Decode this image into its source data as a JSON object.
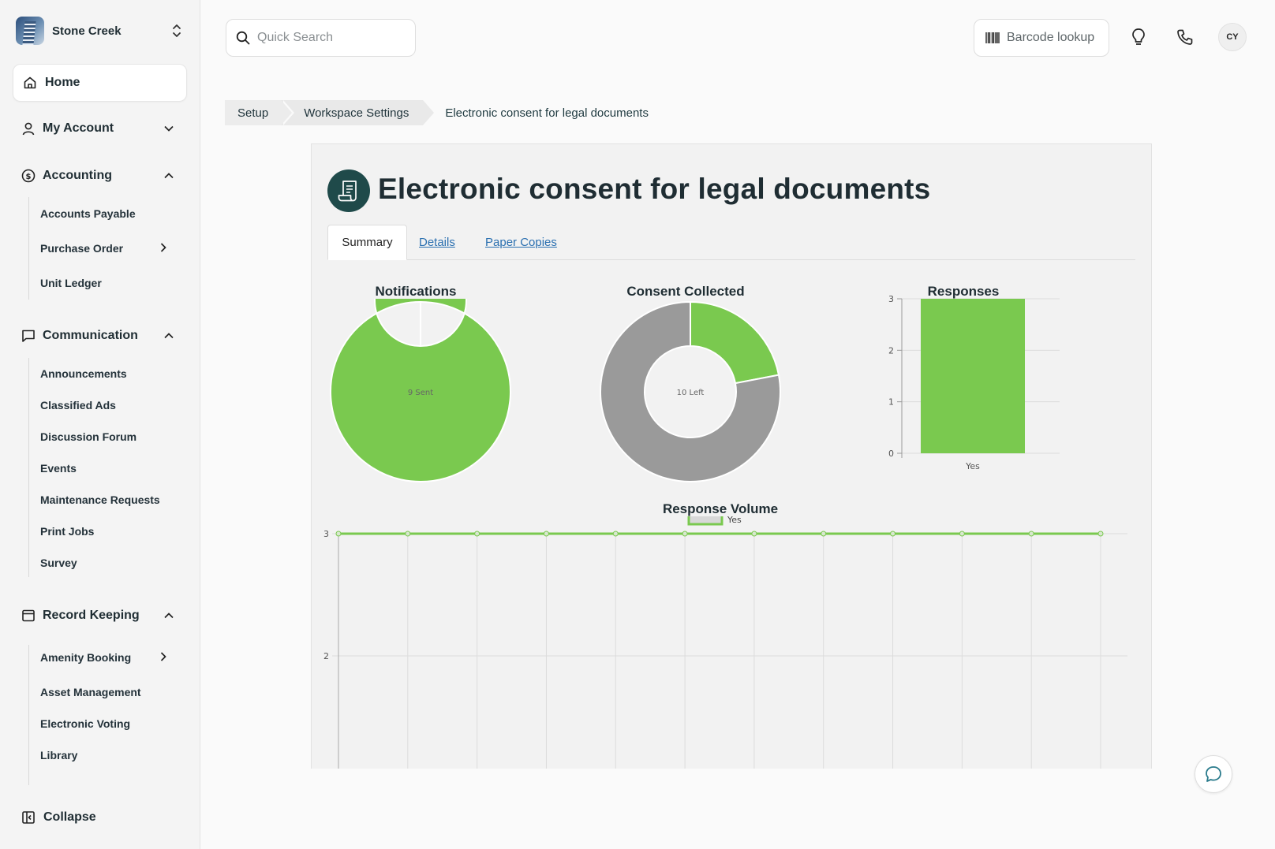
{
  "org": {
    "name": "Stone Creek"
  },
  "nav": {
    "home": "Home",
    "my_account": "My Account",
    "accounting": {
      "label": "Accounting",
      "items": [
        "Accounts Payable",
        "Purchase Order",
        "Unit Ledger"
      ]
    },
    "communication": {
      "label": "Communication",
      "items": [
        "Announcements",
        "Classified Ads",
        "Discussion Forum",
        "Events",
        "Maintenance Requests",
        "Print Jobs",
        "Survey"
      ]
    },
    "record_keeping": {
      "label": "Record Keeping",
      "items": [
        "Amenity Booking",
        "Asset Management",
        "Electronic Voting",
        "Library"
      ]
    },
    "collapse": "Collapse"
  },
  "topbar": {
    "search_placeholder": "Quick Search",
    "barcode": "Barcode lookup",
    "avatar": "CY"
  },
  "breadcrumb": [
    "Setup",
    "Workspace Settings",
    "Electronic consent for legal documents"
  ],
  "page": {
    "title": "Electronic consent for legal documents",
    "tabs": [
      "Summary",
      "Details",
      "Paper Copies"
    ]
  },
  "colors": {
    "green": "#7ac94f",
    "gray": "#9a9a9a",
    "brand": "#1f4a4a",
    "link": "#2a6fb0"
  },
  "chart_data": [
    {
      "type": "pie",
      "title": "Notifications",
      "center_label": "9 Sent",
      "slices": [
        {
          "label": "Sent",
          "value": 9,
          "color": "#7ac94f"
        }
      ]
    },
    {
      "type": "pie",
      "title": "Consent Collected",
      "center_label": "10 Left",
      "slices": [
        {
          "label": "Collected",
          "value": 2.2,
          "color": "#7ac94f"
        },
        {
          "label": "Left",
          "value": 7.8,
          "color": "#9a9a9a"
        }
      ]
    },
    {
      "type": "bar",
      "title": "Responses",
      "categories": [
        "Yes"
      ],
      "values": [
        3
      ],
      "ylim": [
        0,
        3
      ],
      "yticks": [
        0,
        1,
        2,
        3
      ]
    },
    {
      "type": "line",
      "title": "Response Volume",
      "series": [
        {
          "name": "Yes",
          "values": [
            3,
            3,
            3,
            3,
            3,
            3,
            3,
            3,
            3,
            3,
            3,
            3
          ]
        }
      ],
      "yticks": [
        2,
        3
      ],
      "ylim": [
        1,
        3
      ]
    }
  ]
}
